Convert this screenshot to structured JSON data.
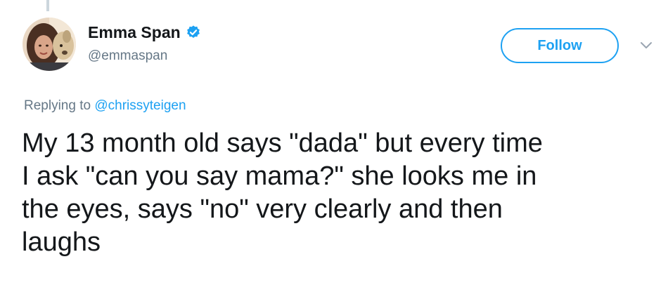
{
  "tweet": {
    "author": {
      "display_name": "Emma Span",
      "handle": "@emmaspan",
      "verified": true,
      "avatar_icon": "user-avatar-photo"
    },
    "follow_label": "Follow",
    "reply_prefix": "Replying to ",
    "reply_to": "@chrissyteigen",
    "text_lines": [
      "My 13 month old says \"dada\" but every time",
      "I ask \"can you say mama?\" she looks me in",
      "the eyes, says \"no\" very clearly and then",
      "laughs"
    ],
    "icons": {
      "verified": "verified-badge-icon",
      "menu": "chevron-down-icon"
    }
  },
  "colors": {
    "brand_blue": "#1da1f2",
    "text_primary": "#14171a",
    "text_secondary": "#657786",
    "thread_line": "#ccd6dd"
  }
}
